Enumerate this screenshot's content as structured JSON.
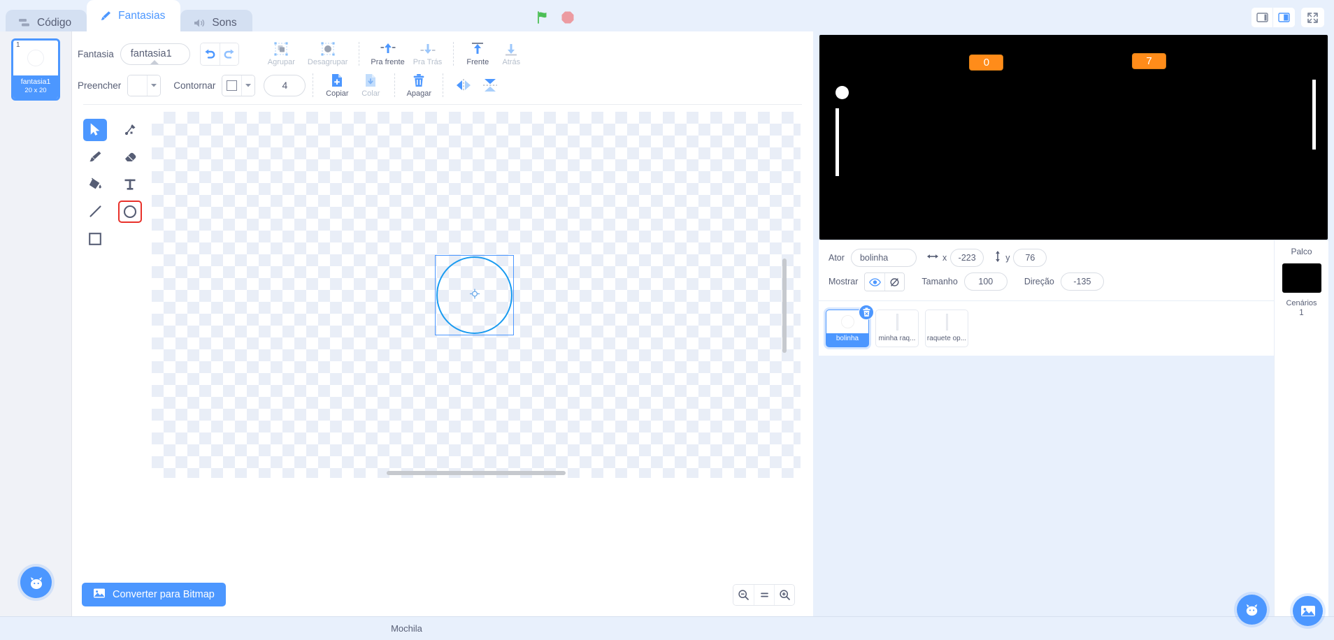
{
  "tabs": [
    {
      "label": "Código",
      "icon": "code-icon",
      "active": false
    },
    {
      "label": "Fantasias",
      "icon": "brush-icon",
      "active": true
    },
    {
      "label": "Sons",
      "icon": "sound-icon",
      "active": false
    }
  ],
  "run_controls": {
    "green_flag": "green-flag-icon",
    "stop": "stop-icon"
  },
  "stage_controls": {
    "small_stage": "small-stage-icon",
    "large_stage": "large-stage-icon",
    "fullscreen": "fullscreen-icon"
  },
  "costumes": [
    {
      "number": "1",
      "name": "fantasia1",
      "size": "20 x 20",
      "selected": true
    }
  ],
  "paint_toolbar": {
    "costume_label": "Fantasia",
    "costume_name": "fantasia1",
    "undo": "undo-icon",
    "redo": "redo-icon",
    "group": {
      "label": "Agrupar",
      "enabled": false
    },
    "ungroup": {
      "label": "Desagrupar",
      "enabled": false
    },
    "forward": {
      "label": "Pra frente",
      "enabled": true
    },
    "backward": {
      "label": "Pra Trás",
      "enabled": false
    },
    "front": {
      "label": "Frente",
      "enabled": true
    },
    "back": {
      "label": "Atrás",
      "enabled": false
    },
    "fill_label": "Preencher",
    "outline_label": "Contornar",
    "outline_width": "4",
    "copy": {
      "label": "Copiar",
      "enabled": true
    },
    "paste": {
      "label": "Colar",
      "enabled": false
    },
    "delete": {
      "label": "Apagar",
      "enabled": true
    },
    "flip_horizontal": "flip-horizontal-icon",
    "flip_vertical": "flip-vertical-icon"
  },
  "tool_palette": [
    {
      "name": "select-tool",
      "icon": "cursor-icon",
      "selected": true,
      "highlighted": false
    },
    {
      "name": "reshape-tool",
      "icon": "reshape-icon",
      "selected": false,
      "highlighted": false
    },
    {
      "name": "brush-tool",
      "icon": "paintbrush-icon",
      "selected": false,
      "highlighted": false
    },
    {
      "name": "eraser-tool",
      "icon": "eraser-icon",
      "selected": false,
      "highlighted": false
    },
    {
      "name": "fill-tool",
      "icon": "paint-bucket-icon",
      "selected": false,
      "highlighted": false
    },
    {
      "name": "text-tool",
      "icon": "text-icon",
      "selected": false,
      "highlighted": false
    },
    {
      "name": "line-tool",
      "icon": "line-icon",
      "selected": false,
      "highlighted": false
    },
    {
      "name": "circle-tool",
      "icon": "circle-icon",
      "selected": false,
      "highlighted": true
    },
    {
      "name": "rectangle-tool",
      "icon": "rectangle-icon",
      "selected": false,
      "highlighted": false
    }
  ],
  "canvas": {
    "shape": "circle",
    "selected": true
  },
  "bottom_bar": {
    "convert_label": "Converter para Bitmap",
    "convert_icon": "image-icon",
    "zoom_out": "zoom-out-icon",
    "zoom_reset": "zoom-reset-icon",
    "zoom_in": "zoom-in-icon"
  },
  "add_costume_fab": "add-costume-icon",
  "stage": {
    "background_color": "#000000",
    "scores": [
      {
        "value": "0",
        "x_pct": 29.5,
        "y_pct": 9.5
      },
      {
        "value": "7",
        "x_pct": 61.5,
        "y_pct": 9
      }
    ],
    "ball": {
      "x_pct": 3.5,
      "y_pct": 44
    },
    "paddles": [
      {
        "name": "left-paddle",
        "x_pct": 3.0,
        "y_pct": 61,
        "h_pct": 33
      },
      {
        "name": "right-paddle",
        "x_pct": 95.5,
        "y_pct": 37,
        "h_pct": 34
      }
    ]
  },
  "sprite_info": {
    "sprite_label": "Ator",
    "sprite_name": "bolinha",
    "x_label": "x",
    "x_value": "-223",
    "y_label": "y",
    "y_value": "76",
    "show_label": "Mostrar",
    "show_icon": "eye-icon",
    "hide_icon": "eye-slash-icon",
    "size_label": "Tamanho",
    "size_value": "100",
    "direction_label": "Direção",
    "direction_value": "-135"
  },
  "sprites": [
    {
      "name": "bolinha",
      "thumb": "circle",
      "selected": true,
      "delete_icon": "trash-icon"
    },
    {
      "name": "minha raq...",
      "thumb": "bar",
      "selected": false
    },
    {
      "name": "raquete op...",
      "thumb": "bar",
      "selected": false
    }
  ],
  "stage_panel": {
    "title": "Palco",
    "subtitle": "Cenários",
    "count": "1"
  },
  "fabs": {
    "add_sprite": "add-sprite-icon",
    "add_backdrop": "add-backdrop-icon"
  },
  "footer": {
    "backpack_label": "Mochila"
  },
  "colors": {
    "accent": "#4c97ff",
    "text": "#575e75",
    "page_bg": "#e8f0fc",
    "score_orange": "#ff8c1a",
    "highlight_red": "#e8312a",
    "stage_black": "#000000"
  }
}
